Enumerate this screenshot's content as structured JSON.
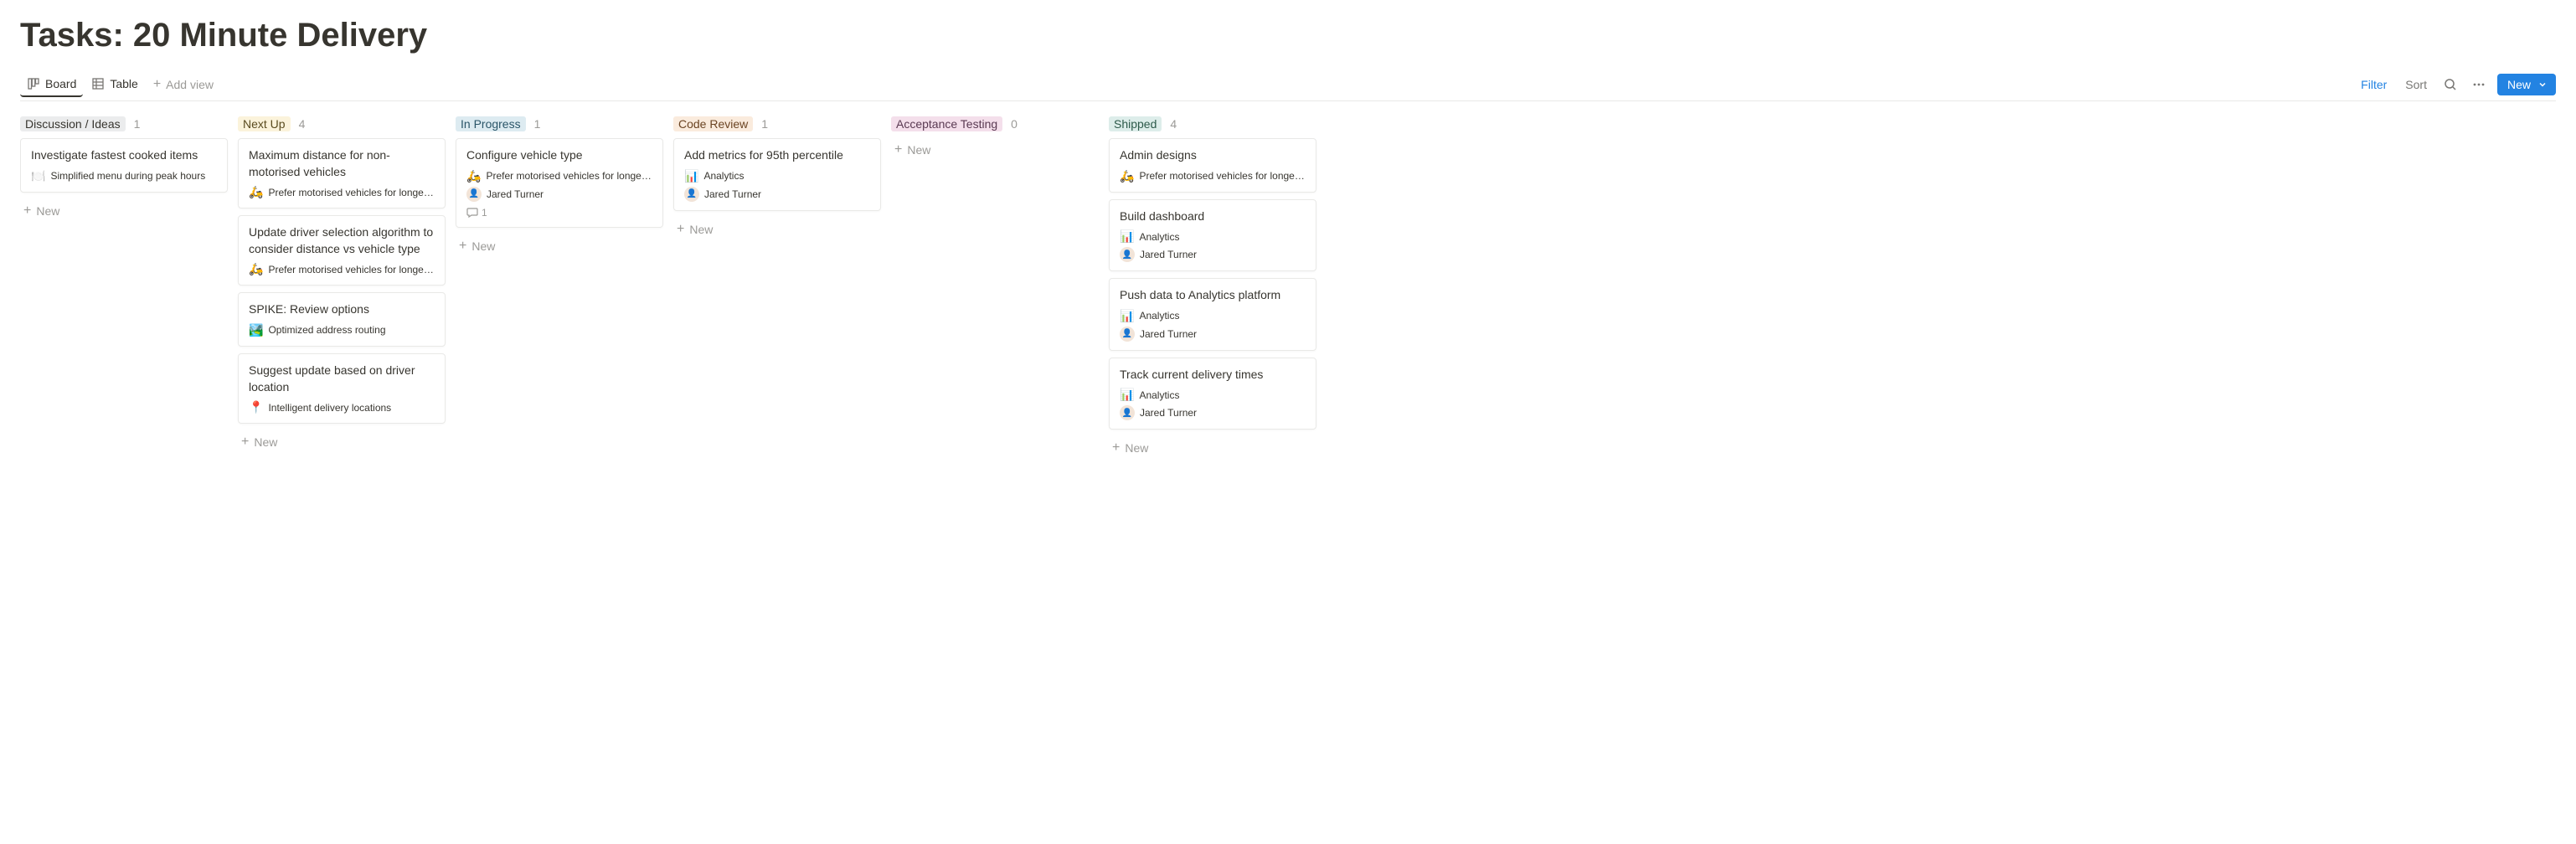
{
  "title": "Tasks: 20 Minute Delivery",
  "views": {
    "board_label": "Board",
    "table_label": "Table",
    "add_view_label": "Add view"
  },
  "toolbar": {
    "filter_label": "Filter",
    "sort_label": "Sort",
    "new_label": "New"
  },
  "new_label": "New",
  "columns": [
    {
      "name": "Discussion / Ideas",
      "count": "1",
      "color_bg": "#ebeced",
      "color_fg": "#37352f",
      "cards": [
        {
          "title": "Investigate fastest cooked items",
          "epic_icon": "🍽️",
          "epic": "Simplified menu during peak hours"
        }
      ]
    },
    {
      "name": "Next Up",
      "count": "4",
      "color_bg": "#fbf3db",
      "color_fg": "#5a4b1f",
      "cards": [
        {
          "title": "Maximum distance for non-motorised vehicles",
          "epic_icon": "🛵",
          "epic": "Prefer motorised vehicles for longer deliveries"
        },
        {
          "title": "Update driver selection algorithm to consider distance vs vehicle type",
          "epic_icon": "🛵",
          "epic": "Prefer motorised vehicles for longer deliveries"
        },
        {
          "title": "SPIKE: Review options",
          "epic_icon": "🏞️",
          "epic": "Optimized address routing"
        },
        {
          "title": "Suggest update based on driver location",
          "epic_icon": "📍",
          "epic": "Intelligent delivery locations"
        }
      ]
    },
    {
      "name": "In Progress",
      "count": "1",
      "color_bg": "#ddebf1",
      "color_fg": "#2a5568",
      "cards": [
        {
          "title": "Configure vehicle type",
          "epic_icon": "🛵",
          "epic": "Prefer motorised vehicles for longer deliveries",
          "assignee": "Jared Turner",
          "comments": "1"
        }
      ]
    },
    {
      "name": "Code Review",
      "count": "1",
      "color_bg": "#faebdd",
      "color_fg": "#6b4423",
      "cards": [
        {
          "title": "Add metrics for 95th percentile",
          "epic_icon": "📊",
          "epic": "Analytics",
          "assignee": "Jared Turner"
        }
      ]
    },
    {
      "name": "Acceptance Testing",
      "count": "0",
      "color_bg": "#f4dfeb",
      "color_fg": "#5a3a52",
      "cards": []
    },
    {
      "name": "Shipped",
      "count": "4",
      "color_bg": "#ddedea",
      "color_fg": "#2d5a4a",
      "cards": [
        {
          "title": "Admin designs",
          "epic_icon": "🛵",
          "epic": "Prefer motorised vehicles for longer deliveries"
        },
        {
          "title": "Build dashboard",
          "epic_icon": "📊",
          "epic": "Analytics",
          "assignee": "Jared Turner"
        },
        {
          "title": "Push data to Analytics platform",
          "epic_icon": "📊",
          "epic": "Analytics",
          "assignee": "Jared Turner"
        },
        {
          "title": "Track current delivery times",
          "epic_icon": "📊",
          "epic": "Analytics",
          "assignee": "Jared Turner"
        }
      ]
    }
  ]
}
